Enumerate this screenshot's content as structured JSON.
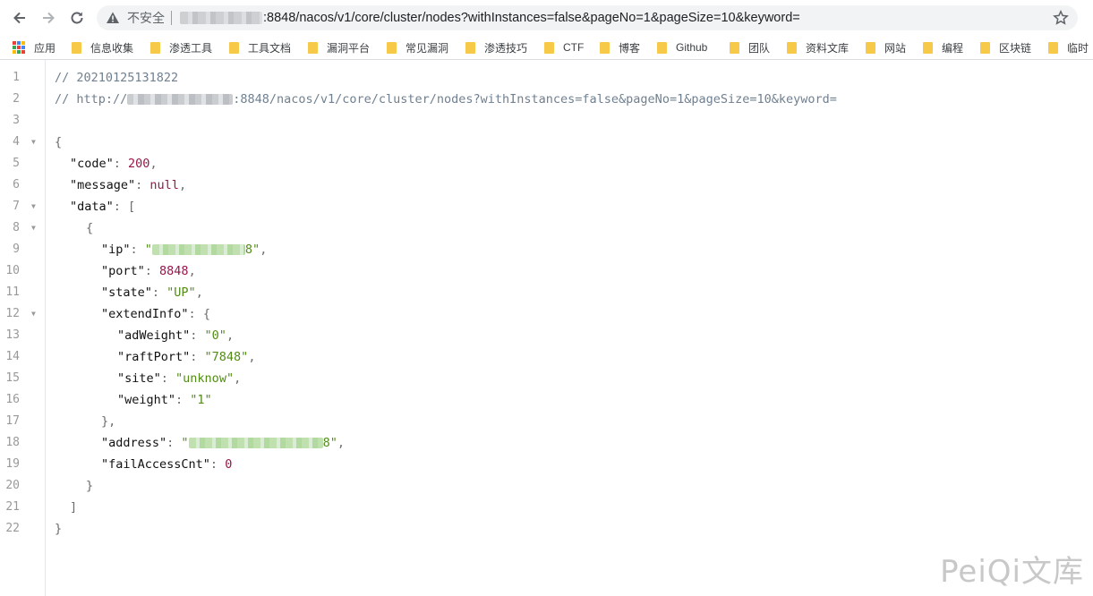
{
  "toolbar": {
    "back_icon": "arrow-left-icon",
    "forward_icon": "arrow-right-icon",
    "reload_icon": "reload-icon",
    "security_label": "不安全",
    "url_visible": ":8848/nacos/v1/core/cluster/nodes?withInstances=false&pageNo=1&pageSize=10&keyword=",
    "star_icon": "star-icon"
  },
  "bookmarks": [
    {
      "label": "应用",
      "icon": "apps-grid-icon"
    },
    {
      "label": "信息收集",
      "icon": "folder-icon"
    },
    {
      "label": "渗透工具",
      "icon": "folder-icon"
    },
    {
      "label": "工具文档",
      "icon": "folder-icon"
    },
    {
      "label": "漏洞平台",
      "icon": "folder-icon"
    },
    {
      "label": "常见漏洞",
      "icon": "folder-icon"
    },
    {
      "label": "渗透技巧",
      "icon": "folder-icon"
    },
    {
      "label": "CTF",
      "icon": "folder-icon"
    },
    {
      "label": "博客",
      "icon": "folder-icon"
    },
    {
      "label": "Github",
      "icon": "folder-icon"
    },
    {
      "label": "团队",
      "icon": "folder-icon"
    },
    {
      "label": "资料文库",
      "icon": "folder-icon"
    },
    {
      "label": "网站",
      "icon": "folder-icon"
    },
    {
      "label": "编程",
      "icon": "folder-icon"
    },
    {
      "label": "区块链",
      "icon": "folder-icon"
    },
    {
      "label": "临时",
      "icon": "folder-icon"
    }
  ],
  "editor": {
    "line_numbers": [
      "1",
      "2",
      "3",
      "4",
      "5",
      "6",
      "7",
      "8",
      "9",
      "10",
      "11",
      "12",
      "13",
      "14",
      "15",
      "16",
      "17",
      "18",
      "19",
      "20",
      "21",
      "22"
    ],
    "comment_timestamp": "// 20210125131822",
    "comment_url_prefix": "// http://",
    "comment_url_suffix": ":8848/nacos/v1/core/cluster/nodes?withInstances=false&pageNo=1&pageSize=10&keyword=",
    "open_brace": "{",
    "close_brace": "}",
    "code_key": "\"code\"",
    "code_value": "200",
    "message_key": "\"message\"",
    "message_value": "null",
    "data_key": "\"data\"",
    "open_bracket": "[",
    "close_bracket": "]",
    "ip_key": "\"ip\"",
    "ip_value_tail": "8\"",
    "port_key": "\"port\"",
    "port_value": "8848",
    "state_key": "\"state\"",
    "state_value": "\"UP\"",
    "extend_key": "\"extendInfo\"",
    "adweight_key": "\"adWeight\"",
    "adweight_value": "\"0\"",
    "raftport_key": "\"raftPort\"",
    "raftport_value": "\"7848\"",
    "site_key": "\"site\"",
    "site_value": "\"unknow\"",
    "weight_key": "\"weight\"",
    "weight_value": "\"1\"",
    "address_key": "\"address\"",
    "address_value_tail": "8\"",
    "failaccess_key": "\"failAccessCnt\"",
    "failaccess_value": "0"
  },
  "watermark": "PeiQi文库",
  "colors": {
    "string": "#528c17",
    "number": "#99154b",
    "comment": "#708090"
  }
}
